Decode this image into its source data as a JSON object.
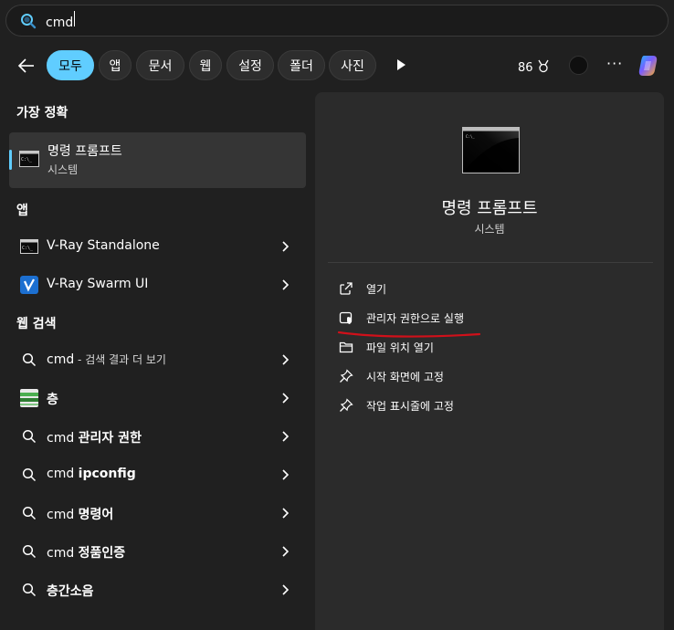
{
  "search": {
    "query": "cmd"
  },
  "tabs": [
    {
      "label": "모두",
      "active": true
    },
    {
      "label": "앱"
    },
    {
      "label": "문서"
    },
    {
      "label": "웹"
    },
    {
      "label": "설정"
    },
    {
      "label": "폴더"
    },
    {
      "label": "사진"
    }
  ],
  "header": {
    "points": "86"
  },
  "colors": {
    "accent": "#60cdff",
    "annotation": "#d0101a"
  },
  "best_match": {
    "heading": "가장 정확",
    "title": "명령 프롬프트",
    "subtitle": "시스템"
  },
  "apps": {
    "heading": "앱",
    "items": [
      {
        "label": "V-Ray Standalone",
        "icon": "console-icon"
      },
      {
        "label": "V-Ray Swarm UI",
        "icon": "vray-icon"
      }
    ]
  },
  "web": {
    "heading": "웹 검색",
    "first": {
      "query": "cmd",
      "suffix": " - 검색 결과 더 보기"
    },
    "items": [
      {
        "prefix": "",
        "bold": "층",
        "icon": "web-thumbnail-icon"
      },
      {
        "prefix": "cmd ",
        "bold": "관리자 권한",
        "icon": "search-icon"
      },
      {
        "prefix": "cmd ",
        "bold": "ipconfig",
        "icon": "search-icon"
      },
      {
        "prefix": "cmd ",
        "bold": "명령어",
        "icon": "search-icon"
      },
      {
        "prefix": "cmd ",
        "bold": "정품인증",
        "icon": "search-icon"
      },
      {
        "prefix": "",
        "bold": "층간소음",
        "icon": "search-icon"
      }
    ]
  },
  "detail": {
    "title": "명령 프롬프트",
    "subtitle": "시스템",
    "actions": [
      {
        "label": "열기",
        "icon": "open-external-icon"
      },
      {
        "label": "관리자 권한으로 실행",
        "icon": "shield-icon"
      },
      {
        "label": "파일 위치 열기",
        "icon": "folder-icon"
      },
      {
        "label": "시작 화면에 고정",
        "icon": "pin-icon"
      },
      {
        "label": "작업 표시줄에 고정",
        "icon": "pin-icon"
      }
    ]
  }
}
